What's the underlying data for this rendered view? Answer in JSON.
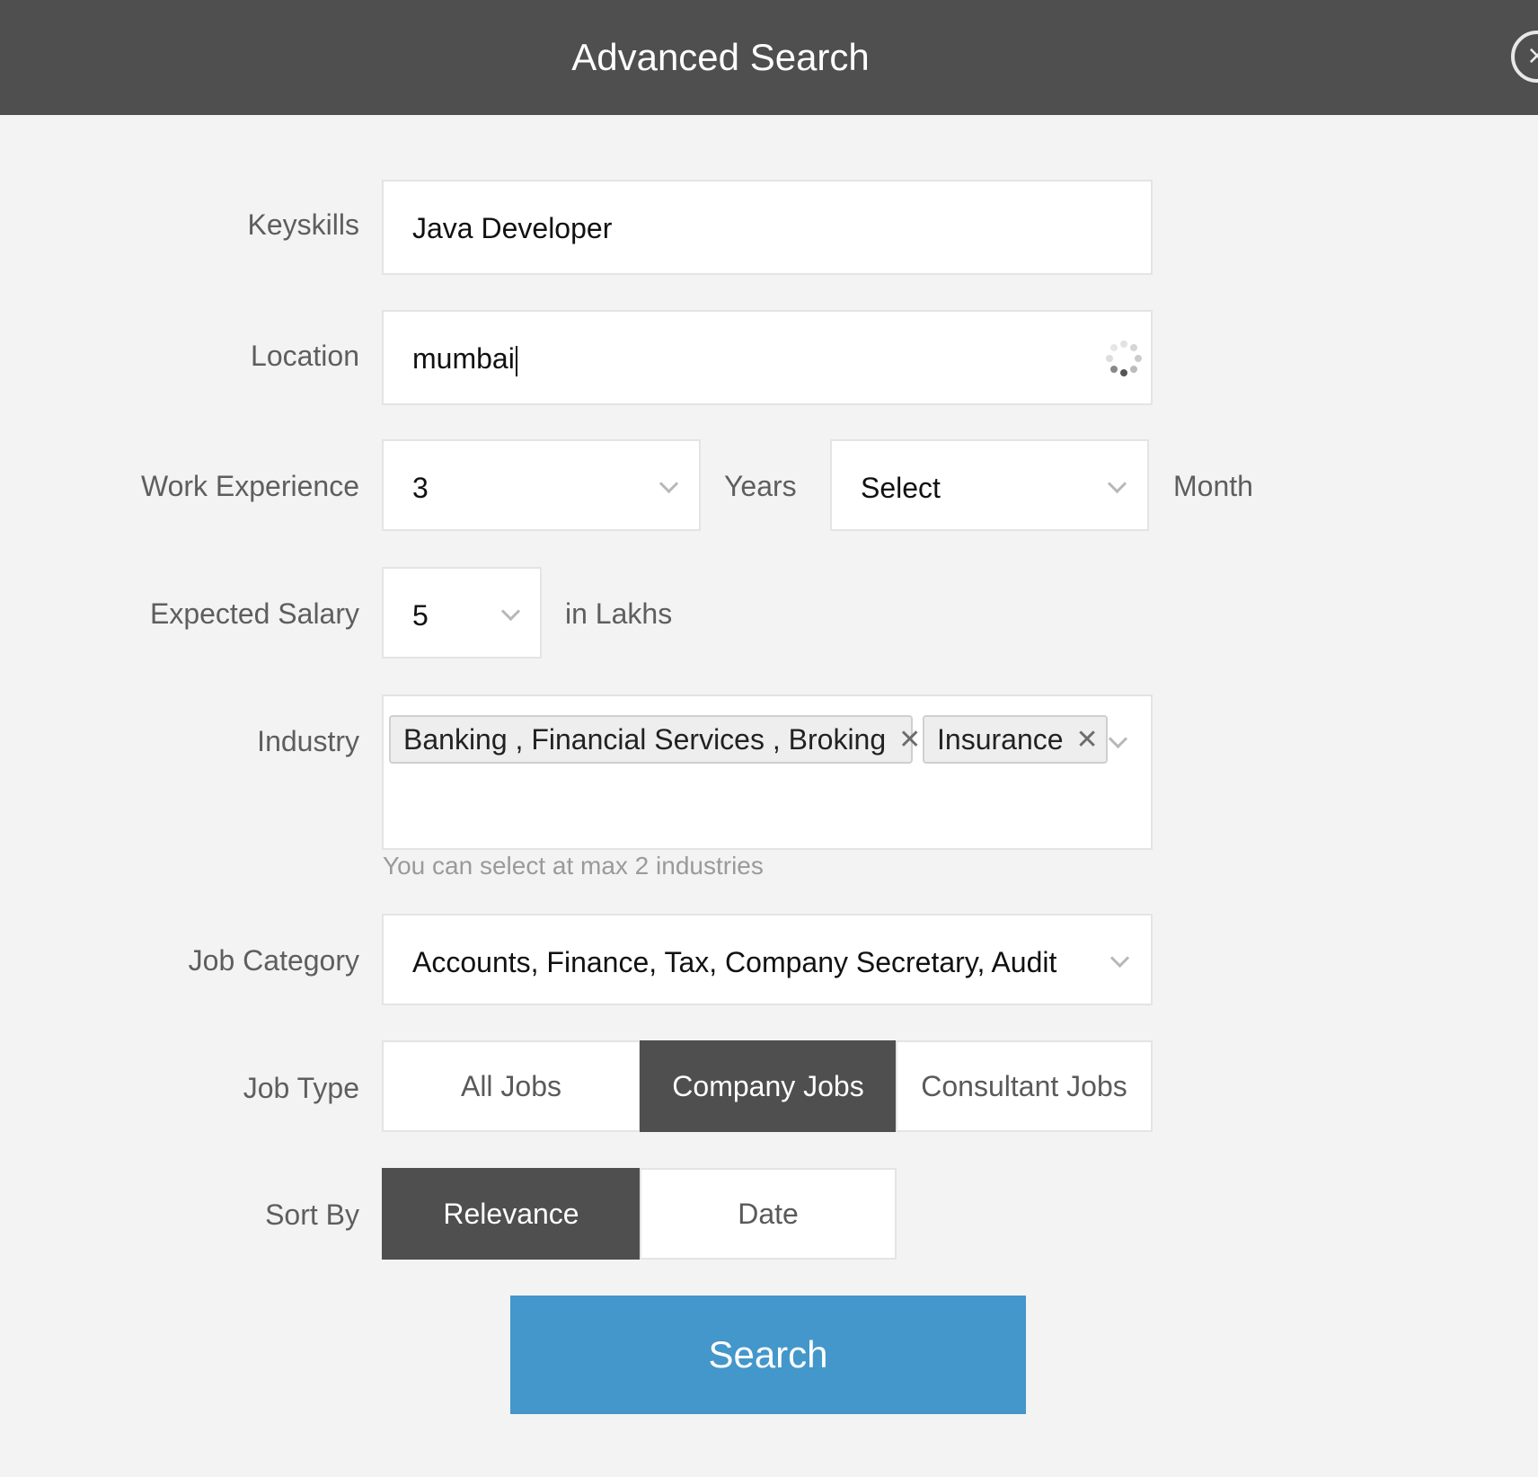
{
  "header": {
    "title": "Advanced Search",
    "close_icon": "close-circle-icon"
  },
  "keyskills": {
    "label": "Keyskills",
    "value": "Java Developer"
  },
  "location": {
    "label": "Location",
    "value": "mumbai",
    "loading_icon": "spinner-icon"
  },
  "work_experience": {
    "label": "Work Experience",
    "years_value": "3",
    "years_suffix": "Years",
    "months_value": "Select",
    "months_suffix": "Month"
  },
  "expected_salary": {
    "label": "Expected Salary",
    "value": "5",
    "suffix": "in Lakhs"
  },
  "industry": {
    "label": "Industry",
    "tags": [
      {
        "label": "Banking , Financial Services , Broking"
      },
      {
        "label": "Insurance"
      }
    ],
    "hint": "You can select at max 2 industries"
  },
  "job_category": {
    "label": "Job Category",
    "value": "Accounts, Finance, Tax, Company Secretary, Audit"
  },
  "job_type": {
    "label": "Job Type",
    "options": [
      {
        "label": "All Jobs",
        "selected": false
      },
      {
        "label": "Company Jobs",
        "selected": true
      },
      {
        "label": "Consultant Jobs",
        "selected": false
      }
    ]
  },
  "sort_by": {
    "label": "Sort By",
    "options": [
      {
        "label": "Relevance",
        "selected": true
      },
      {
        "label": "Date",
        "selected": false
      }
    ]
  },
  "search_button": {
    "label": "Search"
  },
  "colors": {
    "header_bg": "#4f4f4f",
    "page_bg": "#f3f3f3",
    "active_segment": "#4f4f4f",
    "primary_button": "#4397ca"
  }
}
